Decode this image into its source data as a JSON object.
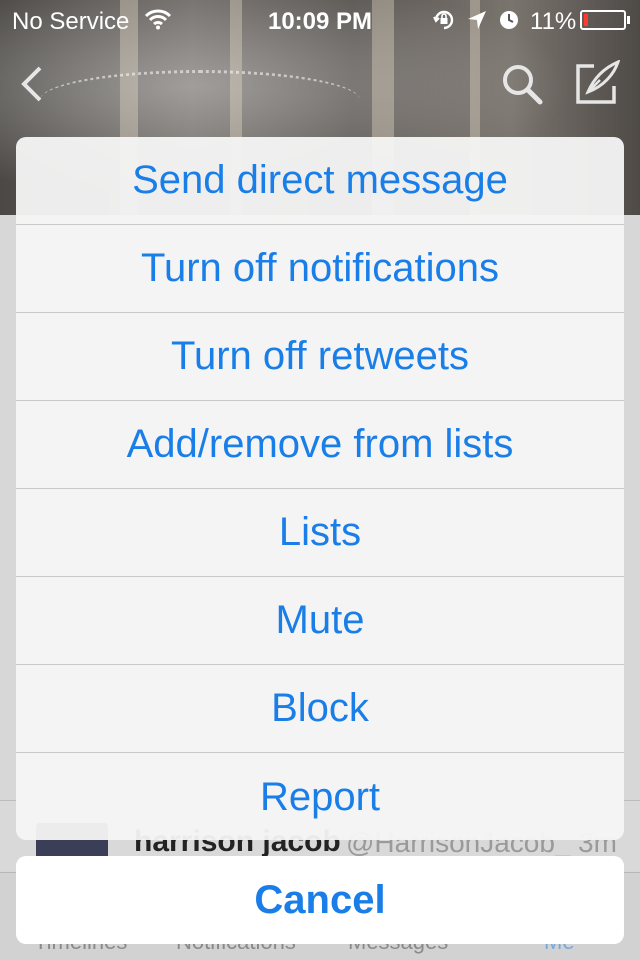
{
  "status_bar": {
    "carrier": "No Service",
    "time": "10:09 PM",
    "battery_percent": "11%",
    "battery_level": 0.11,
    "icons": [
      "wifi-icon",
      "orientation-lock-icon",
      "location-arrow-icon",
      "alarm-icon",
      "battery-icon"
    ]
  },
  "nav": {
    "icons": [
      "back-chevron-icon",
      "search-icon",
      "compose-icon"
    ]
  },
  "background": {
    "tweet": {
      "name": "harrison jacob",
      "handle": "@HarrisonJacob_",
      "time": "3m"
    },
    "tab_bar": {
      "tabs": [
        "Timelines",
        "Notifications",
        "Messages",
        "Me"
      ]
    }
  },
  "action_sheet": {
    "items": [
      "Send direct message",
      "Turn off notifications",
      "Turn off retweets",
      "Add/remove from lists",
      "Lists",
      "Mute",
      "Block",
      "Report"
    ],
    "cancel_label": "Cancel"
  },
  "colors": {
    "accent": "#1a7ee8",
    "battery_low": "#ff3b30"
  }
}
